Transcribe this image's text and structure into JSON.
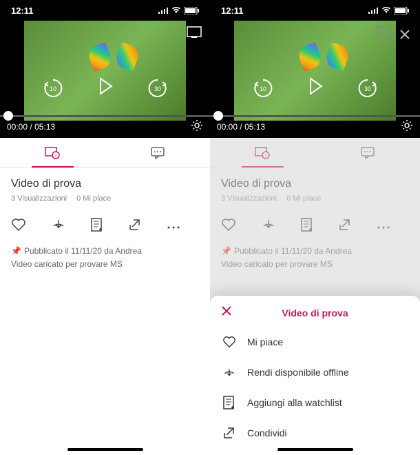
{
  "status": {
    "time": "12:11"
  },
  "player": {
    "current": "00:00",
    "divider": "/",
    "duration": "05:13",
    "back_label": "10",
    "fwd_label": "30"
  },
  "video": {
    "title": "Video di prova",
    "views": "3 Visualizzazioni",
    "likes": "0 Mi piace",
    "published": "Pubblicato il 11/11/20 da Andrea",
    "description": "Video caricato per provare MS"
  },
  "sheet": {
    "title": "Video di prova",
    "like": "Mi piace",
    "offline": "Rendi disponibile offline",
    "watchlist": "Aggiungi alla watchlist",
    "share": "Condividi"
  }
}
